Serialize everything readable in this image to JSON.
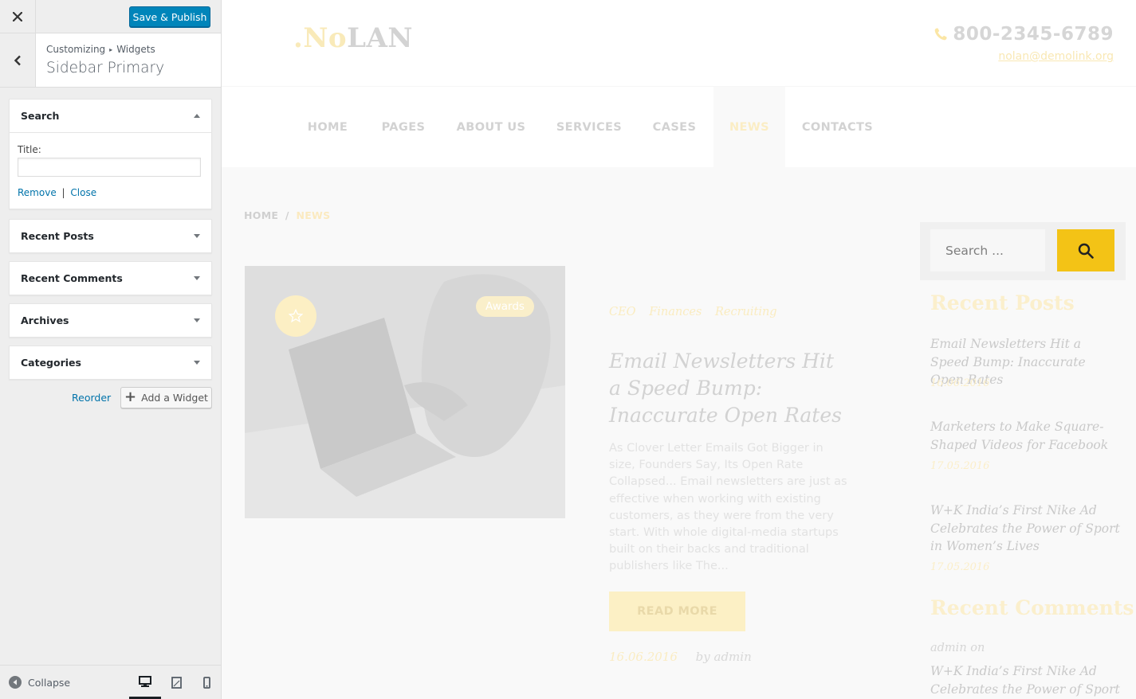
{
  "customizer": {
    "close_label": "×",
    "save_publish": "Save & Publish",
    "breadcrumb": {
      "root": "Customizing",
      "separator": "▸",
      "current": "Widgets"
    },
    "panel_title": "Sidebar Primary",
    "widgets": [
      {
        "name": "Search",
        "expanded": true
      },
      {
        "name": "Recent Posts",
        "expanded": false
      },
      {
        "name": "Recent Comments",
        "expanded": false
      },
      {
        "name": "Archives",
        "expanded": false
      },
      {
        "name": "Categories",
        "expanded": false
      }
    ],
    "search_widget": {
      "title_label": "Title:",
      "title_value": "",
      "remove_label": "Remove",
      "divider": "|",
      "close_label": "Close"
    },
    "reorder_label": "Reorder",
    "add_widget_label": "Add a Widget",
    "collapse_label": "Collapse",
    "devices": [
      "desktop-icon",
      "tablet-icon",
      "mobile-icon"
    ],
    "colors": {
      "primary": "#0085ba",
      "link": "#0073aa"
    }
  },
  "site": {
    "logo": {
      "part1": ".No",
      "part2": "LAN"
    },
    "phone": "800-2345-6789",
    "email": "nolan@demolink.org",
    "nav": [
      "HOME",
      "PAGES",
      "ABOUT US",
      "SERVICES",
      "CASES",
      "NEWS",
      "CONTACTS"
    ],
    "active_nav": "NEWS",
    "breadcrumb": {
      "home": "HOME",
      "separator": "/",
      "current": "NEWS"
    },
    "post": {
      "tag": "Awards",
      "categories": [
        "CEO",
        "Finances",
        "Recruiting"
      ],
      "title": "Email Newsletters Hit a Speed Bump: Inaccurate Open Rates",
      "excerpt": "As Clover Letter Emails Got Bigger in size, Founders Say, Its Open Rate Collapsed... Email newsletters are just as effective when working with existing customers, as they were from the very start. With whole digital-media startups built on their backs and traditional publishers like The...",
      "read_more": "READ MORE",
      "date": "16.06.2016",
      "author": "by admin"
    },
    "search_placeholder": "Search ...",
    "recent_posts_heading": "Recent Posts",
    "recent_posts": [
      {
        "title": "Email Newsletters Hit a Speed Bump: Inaccurate Open Rates",
        "date": "16.06.2016"
      },
      {
        "title": "Marketers to Make Square-Shaped Videos for Facebook",
        "date": "17.05.2016"
      },
      {
        "title": "W+K India’s First Nike Ad Celebrates the Power of Sport in Women’s Lives",
        "date": "17.05.2016"
      }
    ],
    "recent_comments_heading": "Recent Comments",
    "recent_comment": {
      "author": "admin on",
      "post": "W+K India’s First Nike Ad Celebrates the Power of Sport"
    },
    "colors": {
      "accent": "#f3c316"
    }
  }
}
